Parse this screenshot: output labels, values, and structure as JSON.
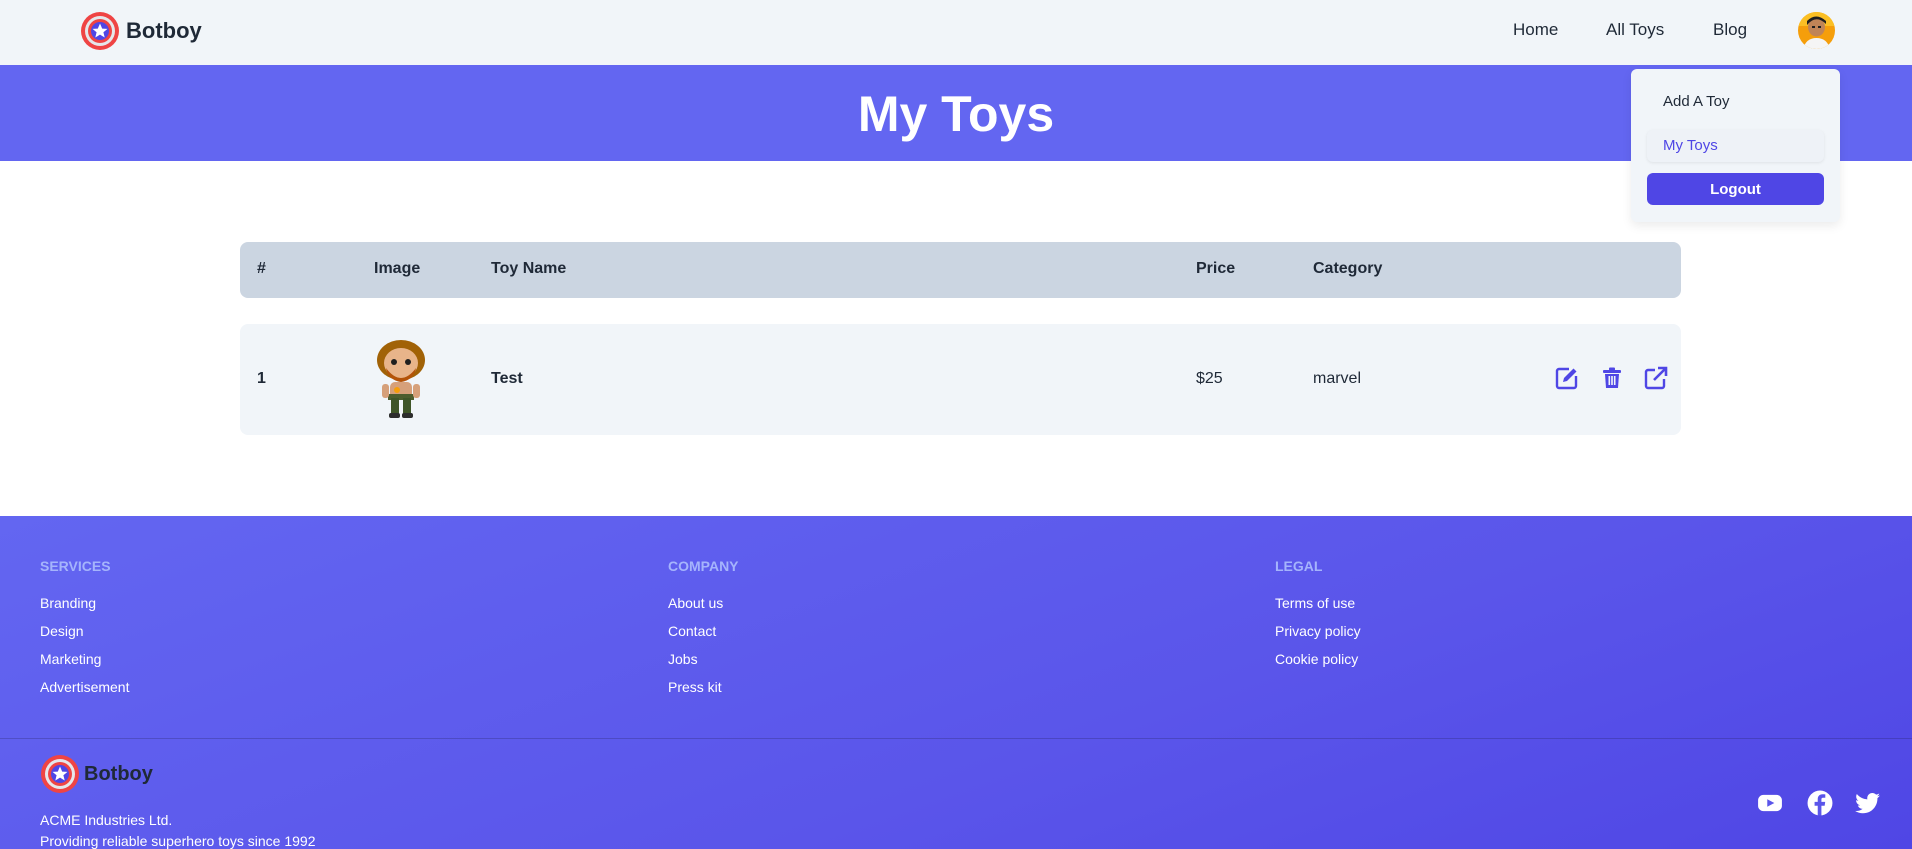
{
  "brand": {
    "name": "Botboy",
    "logo_icon": "shield-star-icon"
  },
  "nav": {
    "links": [
      "Home",
      "All Toys",
      "Blog"
    ],
    "avatar_icon": "user-avatar-icon"
  },
  "hero": {
    "title": "My Toys"
  },
  "dropdown": {
    "items": [
      "Add A Toy",
      "My Toys"
    ],
    "active": "My Toys",
    "logout_label": "Logout"
  },
  "table": {
    "headers": [
      "#",
      "Image",
      "Toy Name",
      "Price",
      "Category"
    ],
    "rows": [
      {
        "index": "1",
        "image_icon": "toy-figure-image",
        "name": "Test",
        "price": "$25",
        "category": "marvel",
        "actions": [
          "edit-icon",
          "delete-icon",
          "open-external-icon"
        ]
      }
    ]
  },
  "footer": {
    "columns": [
      {
        "title": "SERVICES",
        "links": [
          "Branding",
          "Design",
          "Marketing",
          "Advertisement"
        ]
      },
      {
        "title": "COMPANY",
        "links": [
          "About us",
          "Contact",
          "Jobs",
          "Press kit"
        ]
      },
      {
        "title": "LEGAL",
        "links": [
          "Terms of use",
          "Privacy policy",
          "Cookie policy"
        ]
      }
    ],
    "brand_name": "Botboy",
    "company": "ACME Industries Ltd.",
    "tagline": "Providing reliable superhero toys since 1992",
    "socials": [
      "youtube-icon",
      "facebook-icon",
      "twitter-icon"
    ]
  },
  "colors": {
    "primary": "#6366f1",
    "primary_dark": "#4f46e5",
    "nav_bg": "#f1f5f9",
    "table_head_bg": "#cbd5e1",
    "footer_heading": "#a5b4fc"
  }
}
